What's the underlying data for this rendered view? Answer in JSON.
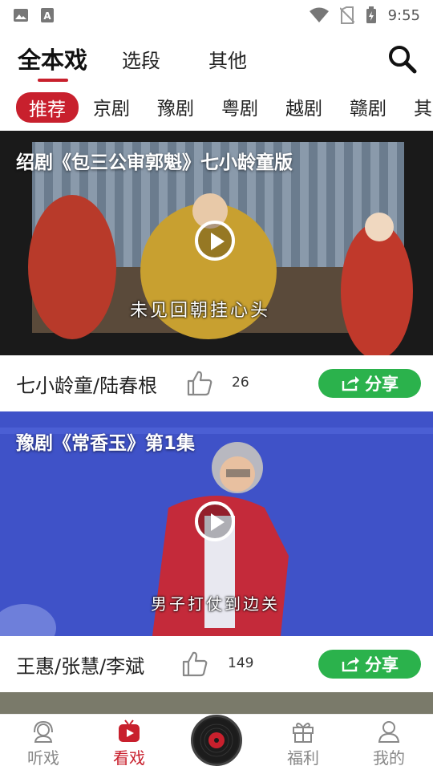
{
  "status_bar": {
    "time": "9:55"
  },
  "top_tabs": [
    {
      "label": "全本戏",
      "active": true
    },
    {
      "label": "选段",
      "active": false
    },
    {
      "label": "其他",
      "active": false
    }
  ],
  "genres": [
    "推荐",
    "京剧",
    "豫剧",
    "粤剧",
    "越剧",
    "赣剧",
    "其"
  ],
  "videos": [
    {
      "title": "绍剧《包三公审郭魁》七小龄童版",
      "caption": "未见回朝挂心头",
      "performers": "七小龄童/陆春根",
      "likes": "26",
      "share_label": "分享"
    },
    {
      "title": "豫剧《常香玉》第1集",
      "caption": "男子打仗到边关",
      "performers": "王惠/张慧/李斌",
      "likes": "149",
      "share_label": "分享"
    }
  ],
  "bottom_nav": [
    {
      "label": "听戏",
      "active": false
    },
    {
      "label": "看戏",
      "active": true
    },
    {
      "label": "福利",
      "active": false
    },
    {
      "label": "我的",
      "active": false
    }
  ],
  "colors": {
    "accent": "#c8202d",
    "share": "#2bb24c"
  }
}
